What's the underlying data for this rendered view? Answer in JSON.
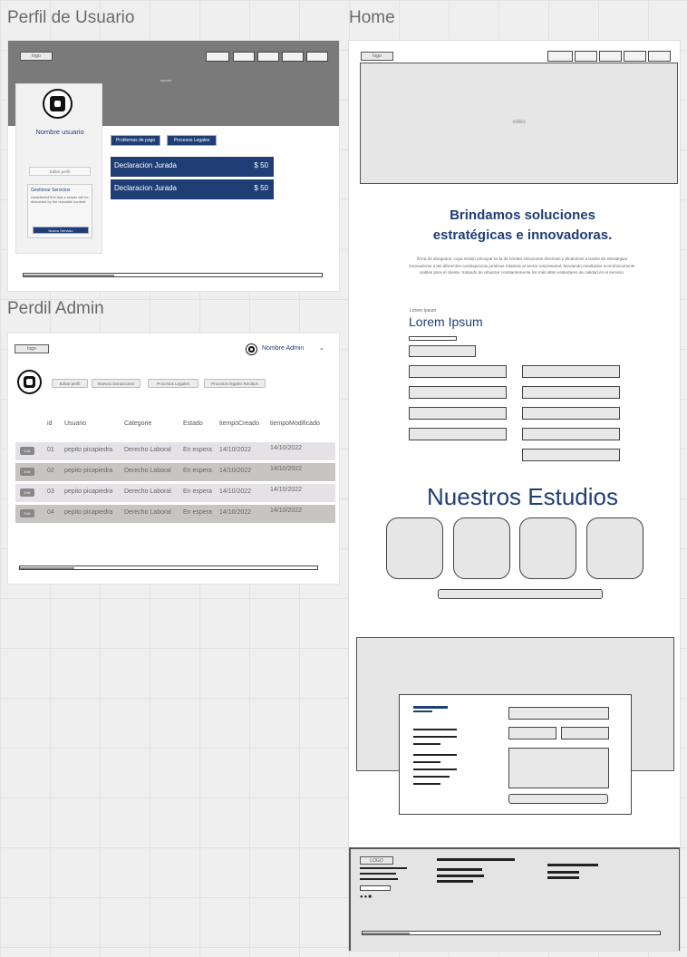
{
  "labels": {
    "perfil_usuario": "Perfil de Usuario",
    "home": "Home",
    "perfil_admin": "Perdil Admin"
  },
  "user_profile": {
    "logo": "logo",
    "banner_text": "banner",
    "user_name": "Nombre usuario",
    "edit_profile": "Editar perfil",
    "service_card_title": "Gestionar Servicios",
    "service_card_text": "establishedText that a reader will be distracted by the readable content",
    "service_card_button": "Nuevo Servicio",
    "tab_problems": "Problemas de pago",
    "tab_legal": "Procesos Legales",
    "declarations": [
      {
        "label": "Declaracion Jurada",
        "amount": "$ 50"
      },
      {
        "label": "Declaracion Jurada",
        "amount": "$ 50"
      }
    ]
  },
  "admin_profile": {
    "logo": "logo",
    "admin_name": "Nombre Admin",
    "pills": [
      "Editar perfil",
      "Nuevos Donaciones",
      "Procesos Legales",
      "Procesos legales Recibos"
    ],
    "columns": [
      "id",
      "Usuario",
      "Categorie",
      "Estado",
      "tiempoCreado",
      "tiempoModificado"
    ],
    "edit_label": "Edit",
    "rows": [
      {
        "id": "01",
        "usuario": "pepito picapiedra",
        "categoria": "Derecho Laboral",
        "estado": "En espera",
        "creado": "14/10/2022",
        "modificado": "14/10/2022"
      },
      {
        "id": "02",
        "usuario": "pepito picapiedra",
        "categoria": "Derecho Laboral",
        "estado": "En espera",
        "creado": "14/10/2022",
        "modificado": "14/10/2022"
      },
      {
        "id": "03",
        "usuario": "pepito picapiedra",
        "categoria": "Derecho Laboral",
        "estado": "En espera",
        "creado": "14/10/2022",
        "modificado": "14/10/2022"
      },
      {
        "id": "04",
        "usuario": "pepito picapiedra",
        "categoria": "Derecho Laboral",
        "estado": "En espera",
        "creado": "14/10/2022",
        "modificado": "14/10/2022"
      }
    ]
  },
  "home": {
    "logo": "logo",
    "hero_text": "video",
    "headline_1": "Brindamos soluciones",
    "headline_2": "estratégicas e innovadoras.",
    "intro": "firma de abogados, cuya misión principal es la de brindar soluciones efectivas y dinámicas a través de estrategias innovadoras a las diferentes contingencias jurídicas relativas al sector empresarial, brindando resultados económicamente viables para el cliente, tratando de alcanzar constantemente los más altos estándares de calidad en el servicio.",
    "lorem_small": "Lorem Ipsum",
    "lorem_big": "Lorem Ipsum",
    "studies_title": "Nuestros Estudios",
    "footer_logo": "LOGO"
  },
  "colors": {
    "navy": "#1f3e75",
    "banner_gray": "#7a7a7a",
    "row_dark": "#c9c4c4",
    "row_light": "#e4e2e6"
  }
}
